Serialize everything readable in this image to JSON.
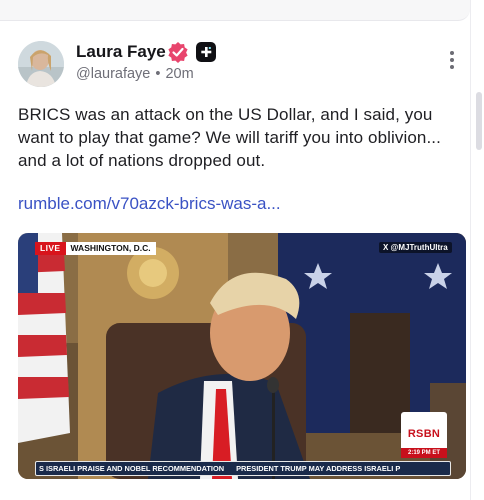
{
  "author": {
    "name": "Laura Faye",
    "handle": "@laurafaye",
    "separator": "•",
    "time": "20m",
    "verified_icon": "verified-check-icon",
    "badge_icon": "plus-badge-icon"
  },
  "post": {
    "text": "BRICS was an attack on the US Dollar, and I said, you want to play that game? We will tariff you into oblivion... and a lot of nations dropped out.",
    "link": "rumble.com/v70azck-brics-was-a..."
  },
  "video": {
    "live_label": "LIVE",
    "location": "WASHINGTON, D.C.",
    "watermark": "X @MJTruthUltra",
    "logo_text": "RSBN",
    "logo_time": "2:19 PM ET",
    "ticker_left": "S ISRAELI PRAISE AND NOBEL RECOMMENDATION",
    "ticker_right": "PRESIDENT TRUMP MAY ADDRESS ISRAELI P"
  },
  "colors": {
    "link": "#3a52c4",
    "verified": "#e8456d",
    "live_red": "#d8141c"
  }
}
